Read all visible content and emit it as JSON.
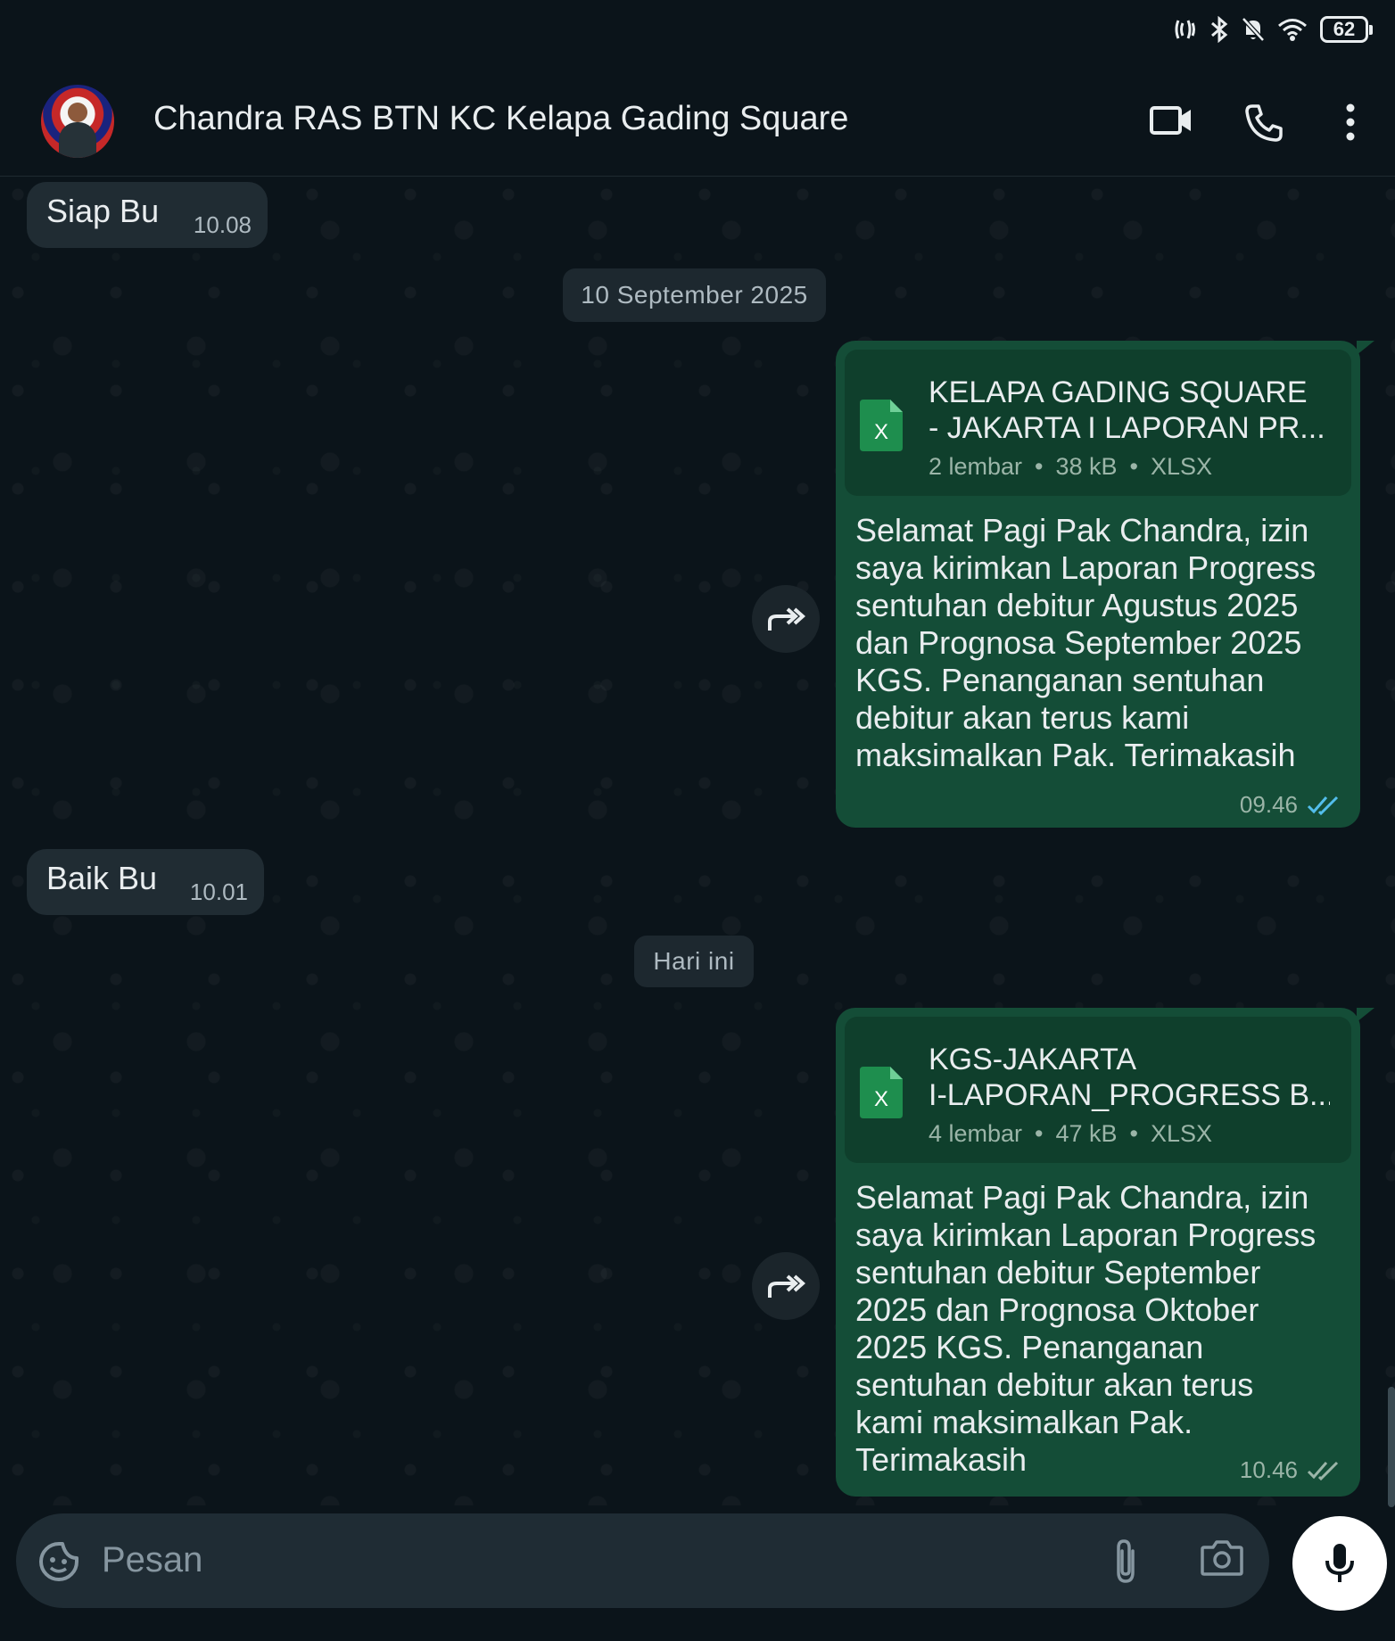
{
  "status_bar": {
    "battery": "62"
  },
  "header": {
    "contact_name": "Chandra RAS BTN KC Kelapa Gading Square"
  },
  "messages": {
    "m1": {
      "text": "Siap Bu",
      "time": "10.08"
    },
    "date1": "10 September 2025",
    "m2": {
      "doc_title_line1": "KELAPA GADING SQUARE",
      "doc_title_line2": "- JAKARTA I LAPORAN PR...",
      "doc_pages": "2 lembar",
      "doc_size": "38 kB",
      "doc_type": "XLSX",
      "text": "Selamat Pagi Pak Chandra, izin saya kirimkan Laporan Progress sentuhan debitur Agustus 2025 dan Prognosa September 2025 KGS. Penanganan sentuhan debitur akan terus kami maksimalkan Pak. Terimakasih",
      "time": "09.46",
      "status": "read"
    },
    "m3": {
      "text": "Baik Bu",
      "time": "10.01"
    },
    "date2": "Hari ini",
    "m4": {
      "doc_title_line1": "KGS-JAKARTA",
      "doc_title_line2": "I-LAPORAN_PROGRESS B...",
      "doc_pages": "4 lembar",
      "doc_size": "47 kB",
      "doc_type": "XLSX",
      "text": "Selamat Pagi Pak Chandra, izin saya kirimkan Laporan Progress sentuhan debitur September 2025 dan Prognosa Oktober 2025 KGS. Penanganan sentuhan debitur akan terus kami maksimalkan Pak. Terimakasih",
      "time": "10.46",
      "status": "delivered"
    }
  },
  "composer": {
    "placeholder": "Pesan"
  },
  "colors": {
    "background": "#0b141a",
    "incoming_bubble": "#202c33",
    "outgoing_bubble": "#144d37",
    "read_ticks": "#53bdeb",
    "excel_green": "#1e8e4e"
  }
}
